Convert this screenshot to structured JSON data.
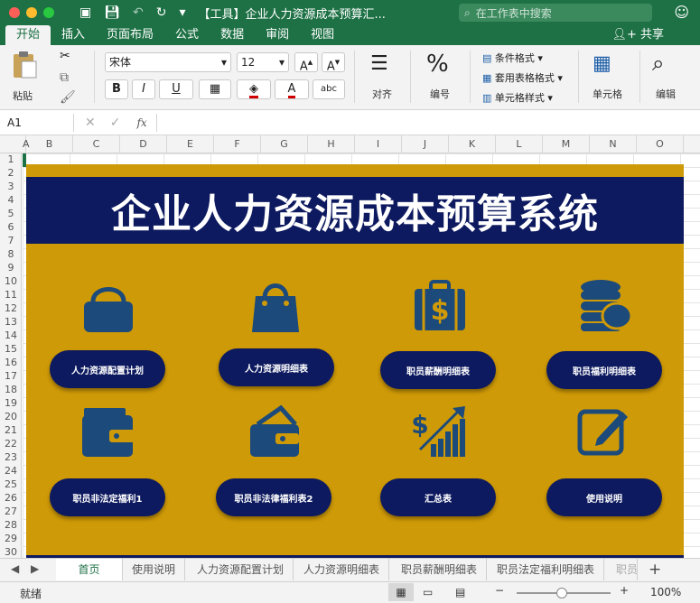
{
  "window": {
    "title": "【工具】企业人力资源成本预算汇...",
    "search_placeholder": "在工作表中搜索"
  },
  "ribbon_tabs": [
    "开始",
    "插入",
    "页面布局",
    "公式",
    "数据",
    "审阅",
    "视图"
  ],
  "share_label": "共享",
  "ribbon": {
    "paste_label": "粘贴",
    "font_name": "宋体",
    "font_size": "12",
    "bold": "B",
    "italic": "I",
    "underline": "U",
    "align_label": "对齐",
    "number_label": "编号",
    "cond_format": "条件格式",
    "table_format": "套用表格格式",
    "cell_style": "单元格样式",
    "cells_label": "单元格",
    "edit_label": "编辑"
  },
  "formula_bar": {
    "cell_ref": "A1",
    "fx": "fx"
  },
  "columns": [
    "A",
    "B",
    "C",
    "D",
    "E",
    "F",
    "G",
    "H",
    "I",
    "J",
    "K",
    "L",
    "M",
    "N",
    "O"
  ],
  "rows": [
    "1",
    "2",
    "3",
    "4",
    "5",
    "6",
    "7",
    "8",
    "9",
    "10",
    "11",
    "12",
    "13",
    "14",
    "15",
    "16",
    "17",
    "18",
    "19",
    "20",
    "21",
    "22",
    "23",
    "24",
    "25",
    "26",
    "27",
    "28",
    "29",
    "30"
  ],
  "dashboard": {
    "title": "企业人力资源成本预算系统",
    "buttons_row1": [
      "人力资源配置计划",
      "人力资源明细表",
      "职员薪酬明细表",
      "职员福利明细表"
    ],
    "buttons_row2": [
      "职员非法定福利1",
      "职员非法律福利表2",
      "汇总表",
      "使用说明"
    ],
    "colors": {
      "panel": "#cf9a07",
      "navy": "#0d1a5f",
      "icon": "#1c4a7a"
    }
  },
  "sheet_tabs": [
    "首页",
    "使用说明",
    "人力资源配置计划",
    "人力资源明细表",
    "职员薪酬明细表",
    "职员法定福利明细表",
    "职员"
  ],
  "status": {
    "ready": "就绪",
    "zoom": "100%"
  }
}
